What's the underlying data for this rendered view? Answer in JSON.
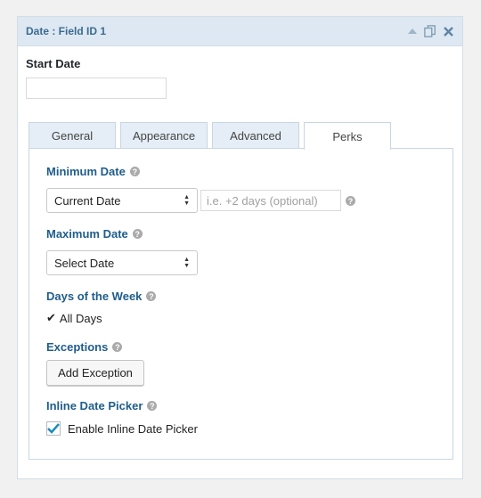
{
  "panel": {
    "title": "Date : Field ID 1",
    "field_label": "Start Date"
  },
  "tabs": [
    {
      "label": "General"
    },
    {
      "label": "Appearance"
    },
    {
      "label": "Advanced"
    },
    {
      "label": "Perks",
      "active": true
    }
  ],
  "perks": {
    "minimum_date": {
      "label": "Minimum Date",
      "select_value": "Current Date",
      "offset_placeholder": "i.e. +2 days (optional)"
    },
    "maximum_date": {
      "label": "Maximum Date",
      "select_value": "Select Date"
    },
    "days_of_week": {
      "label": "Days of the Week",
      "value": "All Days"
    },
    "exceptions": {
      "label": "Exceptions",
      "button_label": "Add Exception"
    },
    "inline_picker": {
      "label": "Inline Date Picker",
      "checkbox_label": "Enable Inline Date Picker",
      "checked": true
    }
  },
  "icons": {
    "help": "?",
    "checkmark": "✔",
    "collapse": "▲",
    "duplicate": "⧉",
    "close": "✕"
  },
  "colors": {
    "header_bg": "#dde8f2",
    "accent_blue": "#1f5d8b",
    "checkbox_blue": "#1e8cbe"
  }
}
